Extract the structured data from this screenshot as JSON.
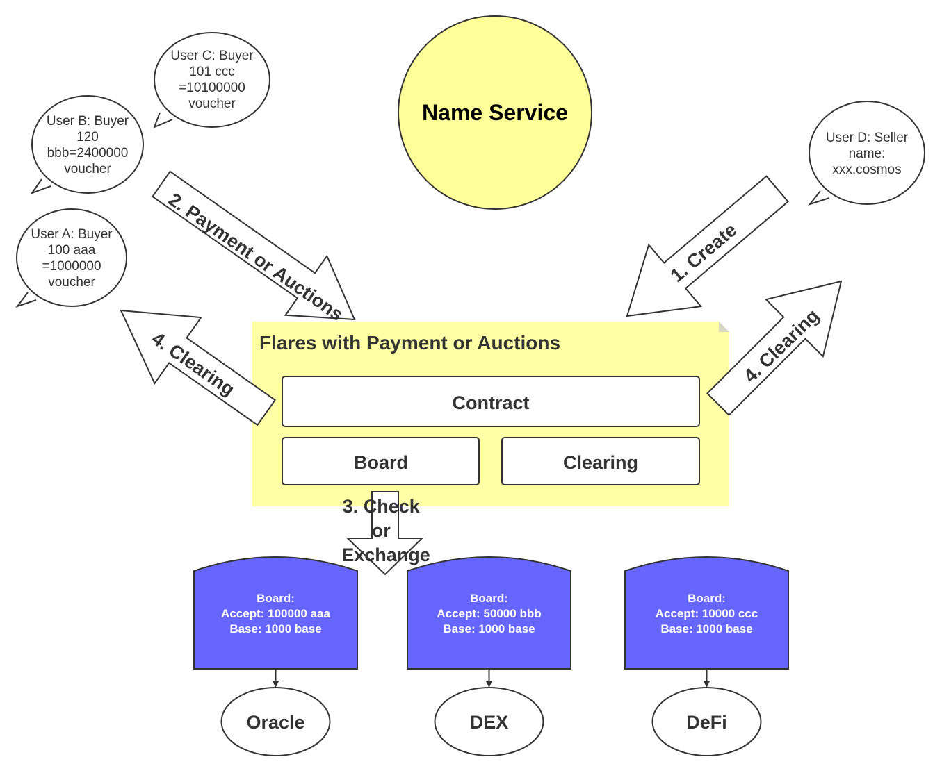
{
  "colors": {
    "name_service_fill": "#ffff99",
    "flares_fill": "#ffffa6",
    "board_fill": "#6666ff",
    "stroke": "#333333"
  },
  "name_service": "Name Service",
  "users": [
    {
      "lines": [
        "User C: Buyer",
        "101 ccc",
        "=10100000",
        "voucher"
      ]
    },
    {
      "lines": [
        "User B: Buyer",
        "120",
        "bbb=2400000",
        "voucher"
      ]
    },
    {
      "lines": [
        "User A: Buyer",
        "100 aaa",
        "=1000000",
        "voucher"
      ]
    },
    {
      "lines": [
        "User D: Seller",
        "name:",
        "xxx.cosmos"
      ]
    }
  ],
  "arrows": {
    "payment": "2. Payment or Auctions",
    "create": "1. Create",
    "clearing_left": "4. Clearing",
    "clearing_right": "4. Clearing",
    "check": [
      "3. Check",
      "or",
      "Exchange"
    ]
  },
  "flares": {
    "title": "Flares with Payment or Auctions",
    "contract": "Contract",
    "board": "Board",
    "clearing": "Clearing"
  },
  "boards": [
    {
      "lines": [
        "Board:",
        "Accept: 100000 aaa",
        "Base: 1000 base"
      ],
      "target": "Oracle"
    },
    {
      "lines": [
        "Board:",
        "Accept: 50000 bbb",
        "Base: 1000 base"
      ],
      "target": "DEX"
    },
    {
      "lines": [
        "Board:",
        "Accept: 10000 ccc",
        "Base: 1000 base"
      ],
      "target": "DeFi"
    }
  ]
}
